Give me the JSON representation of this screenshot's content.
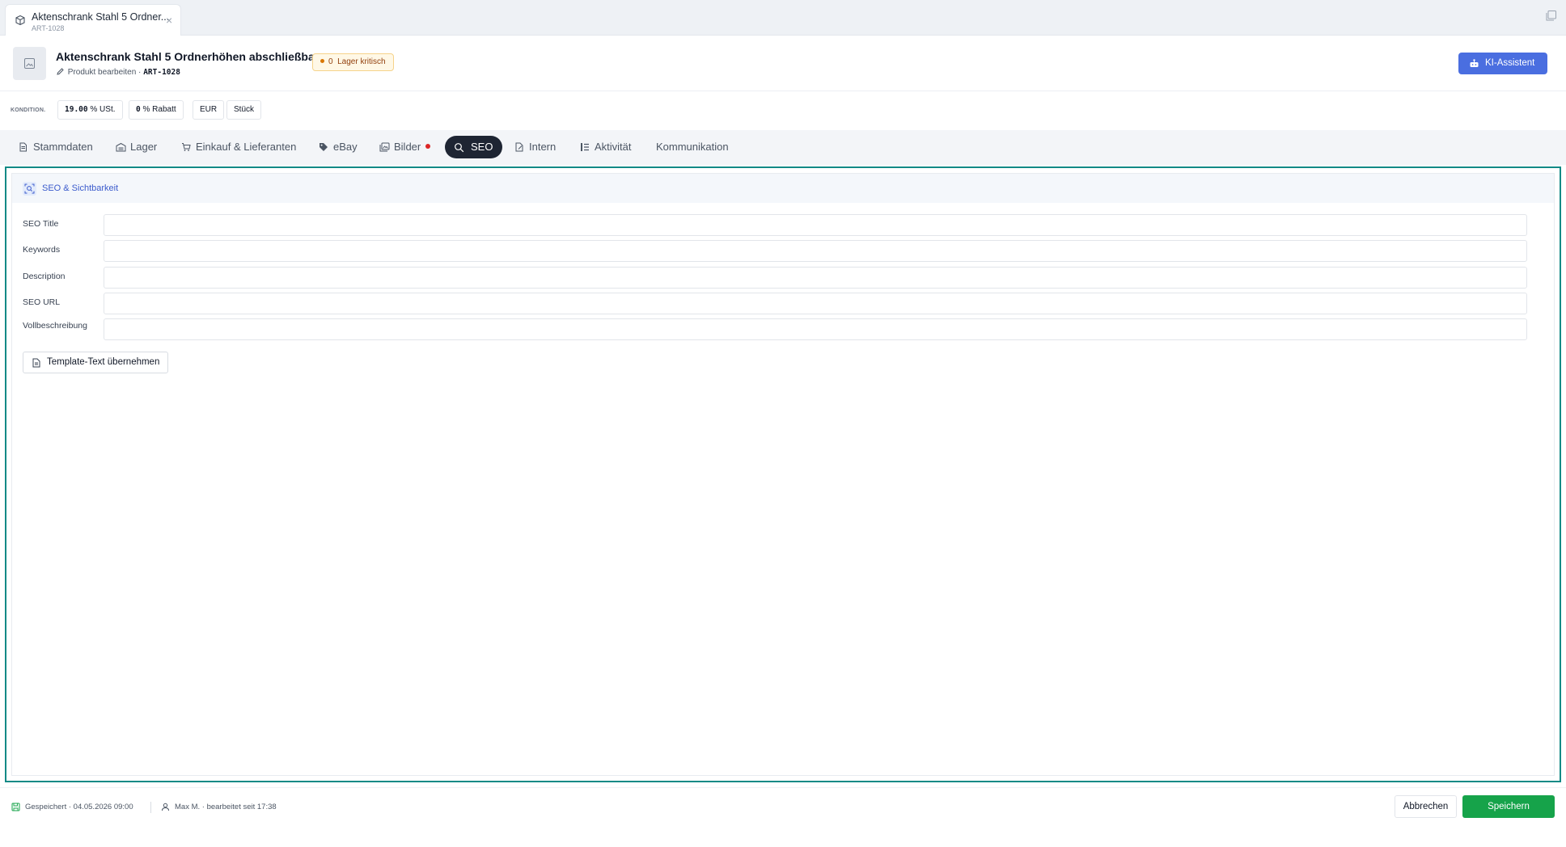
{
  "window_tab": {
    "title": "Aktenschrank Stahl 5 Ordner...",
    "subtitle": "ART-1028",
    "close": "×"
  },
  "header": {
    "title": "Aktenschrank Stahl 5 Ordnerhöhen abschließbar",
    "subtitle_label": "Produkt bearbeiten ·",
    "code": "ART-1028",
    "badge": {
      "count": "0",
      "text": "Lager kritisch"
    },
    "ai_button": "KI-Assistent"
  },
  "konditionen": {
    "label": "KONDITION.",
    "chips": [
      {
        "value": "19.00",
        "suffix": "% USt."
      },
      {
        "value": "0",
        "suffix": "% Rabatt"
      },
      {
        "value": "",
        "suffix": "EUR"
      },
      {
        "value": "",
        "suffix": "Stück"
      }
    ]
  },
  "tabs": [
    {
      "label": "Stammdaten",
      "icon": "document-icon"
    },
    {
      "label": "Lager",
      "icon": "warehouse-icon"
    },
    {
      "label": "Einkauf & Lieferanten",
      "icon": "cart-icon"
    },
    {
      "label": "eBay",
      "icon": "tag-icon"
    },
    {
      "label": "Bilder",
      "icon": "images-icon",
      "dot": true
    },
    {
      "label": "SEO",
      "icon": "seo-search-icon",
      "active": true
    },
    {
      "label": "Intern",
      "icon": "note-icon"
    },
    {
      "label": "Aktivität",
      "icon": "activity-list-icon"
    },
    {
      "label": "Kommunikation",
      "icon": ""
    }
  ],
  "seo_section": {
    "title": "SEO & Sichtbarkeit",
    "fields": [
      {
        "label": "SEO Title",
        "value": ""
      },
      {
        "label": "Keywords",
        "value": ""
      },
      {
        "label": "Description",
        "value": ""
      },
      {
        "label": "SEO URL",
        "value": ""
      },
      {
        "label": "Vollbeschreibung",
        "value": ""
      }
    ],
    "template_button": "Template-Text übernehmen"
  },
  "footer": {
    "saved": "Gespeichert · 04.05.2026 09:00",
    "editing": "Max M. · bearbeitet seit 17:38",
    "cancel": "Abbrechen",
    "save": "Speichern"
  },
  "colors": {
    "accent_blue": "#4a6ee0",
    "active_tab": "#1e2533",
    "panel_border": "#118a86",
    "save_green": "#16a34a",
    "badge_bg": "#fff8e6",
    "error_dot": "#dc2626"
  }
}
